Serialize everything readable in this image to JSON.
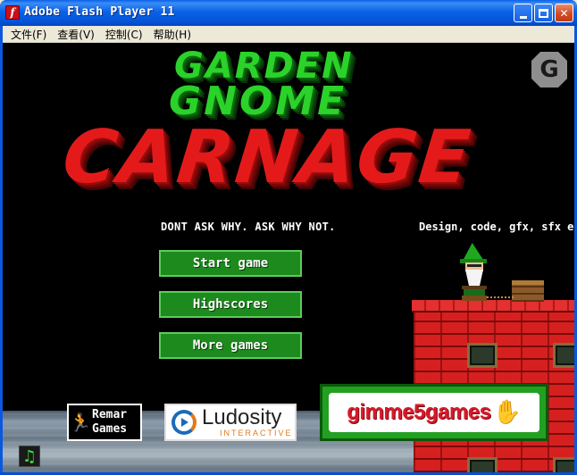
{
  "window": {
    "title": "Adobe Flash Player 11",
    "app_icon": "flash-icon",
    "app_icon_glyph": "f",
    "controls": [
      "minimize-icon",
      "maximize-icon",
      "close-icon"
    ],
    "close_glyph": "✕"
  },
  "menubar": {
    "items": [
      "文件(F)",
      "查看(V)",
      "控制(C)",
      "帮助(H)"
    ]
  },
  "game": {
    "title_line1": "GARDEN",
    "title_line2": "GNOME",
    "title_line3": "CARNAGE",
    "corner_logo": "G",
    "tagline": "DONT ASK WHY. ASK WHY NOT.",
    "credits": "Design, code, gfx, sfx ed",
    "buttons": {
      "start": "Start game",
      "highscores": "Highscores",
      "more": "More games"
    },
    "sponsors": {
      "remar_line1": "Remar",
      "remar_line2": "Games",
      "remar_figure": "🏃",
      "ludosity_name": "Ludosity",
      "ludosity_sub": "INTERACTIVE",
      "gimme5": "gimme5games",
      "gimme5_hand": "✋"
    },
    "music_toggle_glyph": "♫"
  },
  "colors": {
    "title_bar": "#0a58e0",
    "garden_gnome_green": "#2ad22a",
    "carnage_red": "#e41a1a",
    "menu_button_bg": "#1c8a1c",
    "house_red": "#d62020"
  }
}
